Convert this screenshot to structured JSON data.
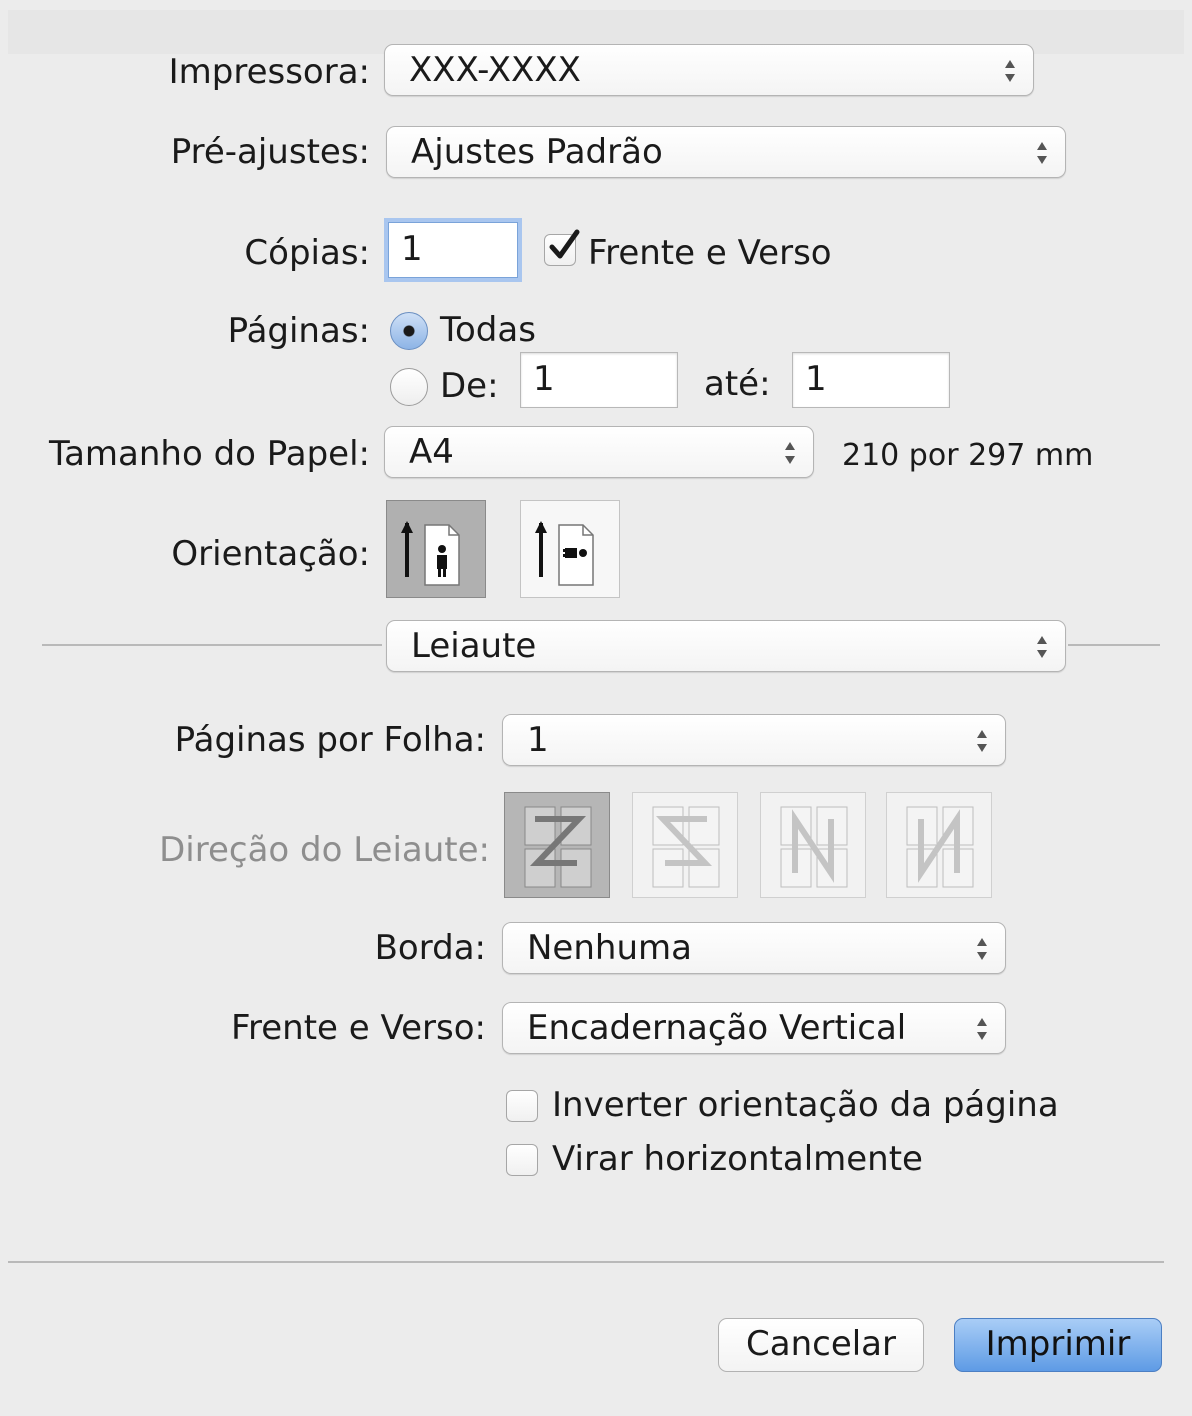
{
  "printer": {
    "label": "Impressora:",
    "value": "XXX-XXXX"
  },
  "presets": {
    "label": "Pré-ajustes:",
    "value": "Ajustes Padrão"
  },
  "copies": {
    "label": "Cópias:",
    "value": "1",
    "duplex_label": "Frente e Verso",
    "duplex_checked": true
  },
  "pages": {
    "label": "Páginas:",
    "all_label": "Todas",
    "from_label": "De:",
    "from_value": "1",
    "to_label": "até:",
    "to_value": "1",
    "selected": "all"
  },
  "paper_size": {
    "label": "Tamanho do Papel:",
    "value": "A4",
    "dimensions": "210 por 297 mm"
  },
  "orientation": {
    "label": "Orientação:",
    "options": [
      "portrait-icon",
      "landscape-icon"
    ],
    "selected": "portrait"
  },
  "section": {
    "value": "Leiaute"
  },
  "layout": {
    "pages_per_sheet": {
      "label": "Páginas por Folha:",
      "value": "1"
    },
    "direction": {
      "label": "Direção do Leiaute:",
      "options": [
        "z-direction-icon",
        "reverse-z-direction-icon",
        "n-direction-icon",
        "reverse-n-direction-icon"
      ],
      "enabled": false
    },
    "border": {
      "label": "Borda:",
      "value": "Nenhuma"
    },
    "duplex": {
      "label": "Frente e Verso:",
      "value": "Encadernação Vertical"
    },
    "reverse_orientation": {
      "label": "Inverter orientação da página",
      "checked": false
    },
    "flip_horizontal": {
      "label": "Virar horizontalmente",
      "checked": false
    }
  },
  "buttons": {
    "cancel": "Cancelar",
    "print": "Imprimir"
  },
  "colors": {
    "accent": "#5e9be5",
    "focus_ring": "#a9c6ef",
    "background": "#ececec"
  }
}
